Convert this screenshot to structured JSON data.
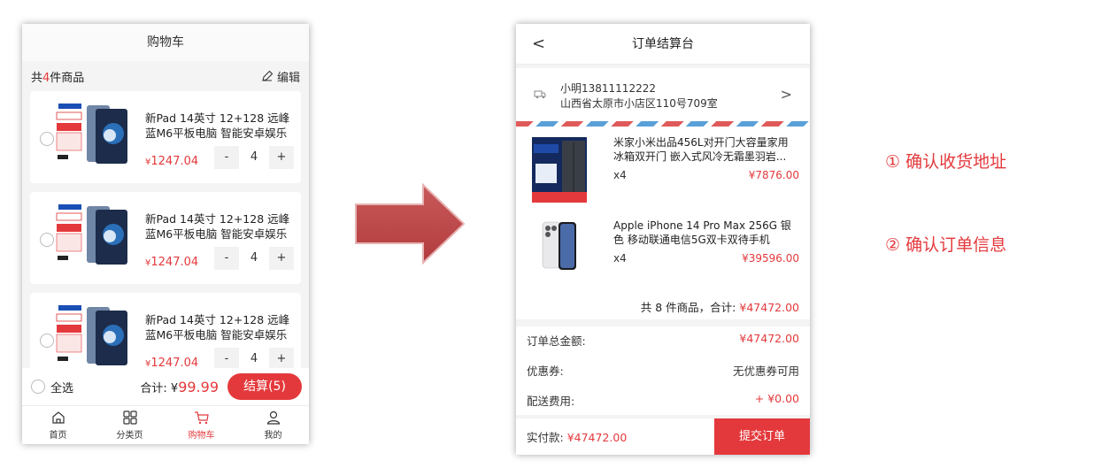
{
  "cart": {
    "title": "购物车",
    "count_prefix": "共",
    "count": "4",
    "count_suffix": "件商品",
    "edit_label": "编辑",
    "items": [
      {
        "title": "新Pad 14英寸 12+128 远峰蓝M6平板电脑 智能安卓娱乐十...",
        "price_symbol": "¥",
        "price": "1247.04",
        "minus": "-",
        "qty": "4",
        "plus": "+"
      },
      {
        "title": "新Pad 14英寸 12+128 远峰蓝M6平板电脑 智能安卓娱乐十...",
        "price_symbol": "¥",
        "price": "1247.04",
        "minus": "-",
        "qty": "4",
        "plus": "+"
      },
      {
        "title": "新Pad 14英寸 12+128 远峰蓝M6平板电脑 智能安卓娱乐十...",
        "price_symbol": "¥",
        "price": "1247.04",
        "minus": "-",
        "qty": "4",
        "plus": "+"
      }
    ],
    "select_all": "全选",
    "total_label": "合计: ¥",
    "total_value": "99.99",
    "checkout_label": "结算(5)",
    "tabs": [
      {
        "label": "首页",
        "icon": "home-icon"
      },
      {
        "label": "分类页",
        "icon": "category-icon"
      },
      {
        "label": "购物车",
        "icon": "cart-icon",
        "active": true
      },
      {
        "label": "我的",
        "icon": "user-icon"
      }
    ],
    "accent_color": "#e4393c"
  },
  "checkout": {
    "title": "订单结算台",
    "back_glyph": "<",
    "address": {
      "name_phone": "小明13811112222",
      "line": "山西省太原市小店区110号709室",
      "chevron": ">"
    },
    "items": [
      {
        "title": "米家小米出品456L对开门大容量家用冰箱双开门 嵌入式风冷无霜墨羽岩...",
        "qty": "x4",
        "price": "¥7876.00"
      },
      {
        "title": "Apple iPhone 14 Pro Max 256G 银色 移动联通电信5G双卡双待手机",
        "qty": "x4",
        "price": "¥39596.00"
      }
    ],
    "order_sum_label": "共 8 件商品，合计:",
    "order_sum_value": "¥47472.00",
    "summary": [
      {
        "label": "订单总金额:",
        "value": "¥47472.00",
        "highlight": true
      },
      {
        "label": "优惠券:",
        "value": "无优惠券可用",
        "highlight": false
      },
      {
        "label": "配送费用:",
        "value": "+ ¥0.00",
        "highlight": true
      }
    ],
    "pay_label": "实付款:",
    "pay_value": "¥47472.00",
    "submit_label": "提交订单"
  },
  "annotations": [
    "① 确认收货地址",
    "② 确认订单信息"
  ]
}
